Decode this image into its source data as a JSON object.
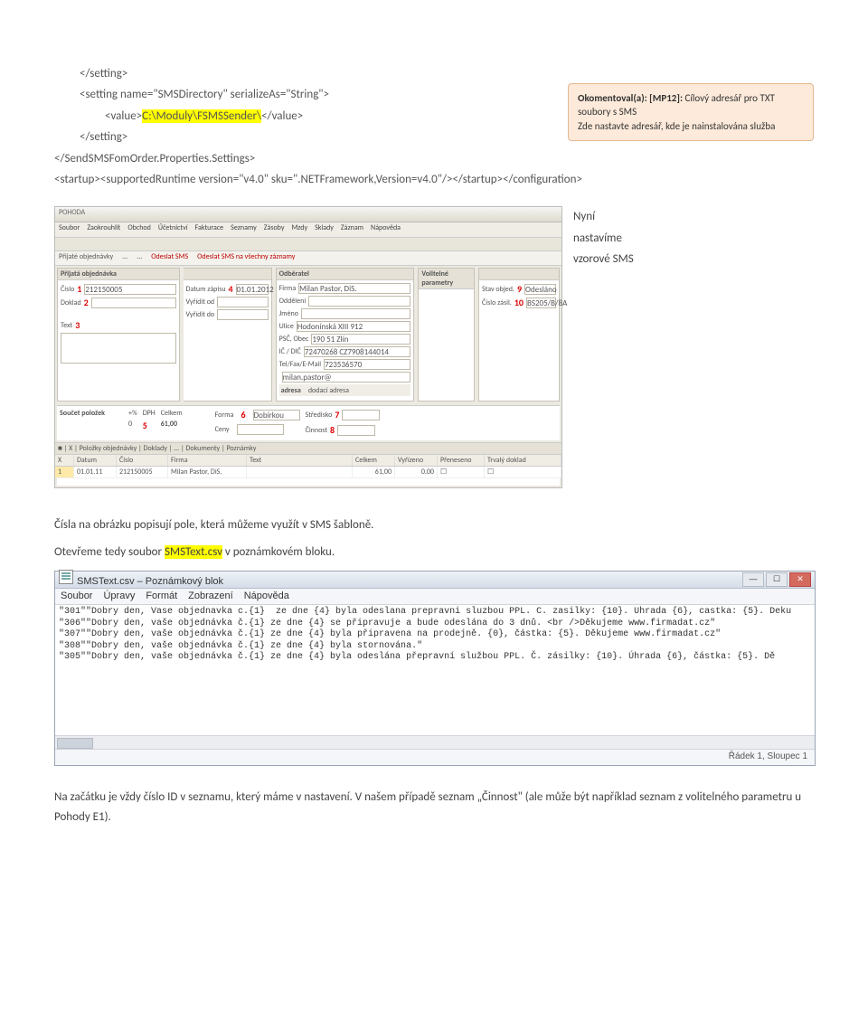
{
  "code": {
    "l1": "</setting>",
    "l2_a": "<setting name=\"SMSDirectory\" serializeAs=\"String\">",
    "l3_a": "<value>",
    "l3_hl": "C:\\Moduly\\FSMSSender\\",
    "l3_b": "</value>",
    "l4": "</setting>",
    "l5": "</SendSMSFomOrder.Properties.Settings>",
    "l6": "<startup><supportedRuntime version=\"v4.0\" sku=\".NETFramework,Version=v4.0\"/></startup></configuration>"
  },
  "comment": {
    "head": "Okomentoval(a): [MP12]: ",
    "body1": "Cílový adresář pro TXT soubory s SMS",
    "body2": "Zde nastavte adresář, kde je nainstalována služba"
  },
  "side_note": {
    "l1": "Nyní",
    "l2": "nastavíme",
    "l3": "vzorové SMS"
  },
  "app": {
    "title": "POHODA",
    "menu": [
      "Soubor",
      "Zaokrouhlit",
      "Obchod",
      "Účetnictví",
      "Fakturace",
      "Seznamy",
      "Zásoby",
      "Mzdy",
      "Sklady",
      "Záznam",
      "Nápověda"
    ],
    "subbar": [
      "Přijaté objednávky",
      "...",
      "...",
      "Odeslat SMS",
      "Odeslat SMS na všechny záznamy"
    ],
    "panel1": {
      "head": "Přijatá objednávka",
      "rows": [
        {
          "lbl": "Číslo",
          "num": "1",
          "val": "212150005"
        },
        {
          "lbl": "Doklad",
          "num": "2",
          "val": ""
        },
        {
          "lbl": "",
          "num": "",
          "val": ""
        },
        {
          "lbl": "Text",
          "num": "3",
          "val": ""
        }
      ],
      "rows2": [
        {
          "lbl": "Datum zápisu",
          "num": "4",
          "val": "01.01.2012"
        },
        {
          "lbl": "Vyřídit od",
          "val": ""
        },
        {
          "lbl": "Vyřídit do",
          "val": ""
        }
      ]
    },
    "panel2": {
      "head": "Odběratel",
      "rows": [
        {
          "lbl": "Firma",
          "val": "Milan Pastor, DiS."
        },
        {
          "lbl": "Oddělení",
          "val": ""
        },
        {
          "lbl": "Jméno",
          "val": ""
        },
        {
          "lbl": "Ulice",
          "val": "Hodonínská XIII 912"
        },
        {
          "lbl": "PSČ, Obec",
          "val": "190 51 Zlín"
        },
        {
          "lbl": "IČ / DIČ",
          "val": "72470268   CZ7908144014"
        },
        {
          "lbl": "Tel/Fax/E-Mail",
          "val": "723536570"
        },
        {
          "lbl": "",
          "val": "milan.pastor@"
        },
        {
          "lbl": "adresa",
          "val": "dodací adresa"
        }
      ]
    },
    "panel3": {
      "head": "Volitelné parametry"
    },
    "panel4": {
      "rows": [
        {
          "lbl": "Stav objed.",
          "num": "9",
          "val": "Odesláno"
        },
        {
          "lbl": "Číslo zásil.",
          "num": "10",
          "val": "BS205/B/8A"
        }
      ]
    },
    "sum": {
      "head": "Součet položek",
      "cols": [
        "+%",
        "DPH",
        "Celkem"
      ],
      "vals": [
        "0",
        "5",
        "61,00"
      ],
      "forma_lbl": "Forma",
      "forma_num": "6",
      "forma_val": "Dobírkou",
      "stredisko_lbl": "Středisko",
      "stredisko_num": "7",
      "cinnost_lbl": "Činnost",
      "cinnost_num": "8",
      "cena_lbl": "Ceny"
    },
    "grid": {
      "tabs": "■ | X | Položky objednávky | Doklady | ... | Dokumenty | Poznámky",
      "head": [
        "X",
        "Datum",
        "Číslo",
        "Firma",
        "Text",
        "Celkem",
        "Vyřízeno",
        "Přeneseno",
        "Trvalý doklad"
      ],
      "row": [
        "",
        "01.01.11",
        "212150005",
        "Milan Pastor, DiS.",
        "",
        "61,00",
        "",
        "",
        ""
      ]
    }
  },
  "para1": "Čísla na obrázku popisují pole, která můžeme využít v SMS šabloně.",
  "para2_a": "Otevřeme tedy soubor ",
  "para2_hl": "SMSText.csv",
  "para2_b": " v poznámkovém bloku.",
  "notepad": {
    "title": "SMSText.csv – Poznámkový blok",
    "menu": [
      "Soubor",
      "Úpravy",
      "Formát",
      "Zobrazení",
      "Nápověda"
    ],
    "lines": [
      "\"301\"\"Dobry den, Vase objednavka c.{1}  ze dne {4} byla odeslana prepravni sluzbou PPL. C. zasilky: {10}. Uhrada {6}, castka: {5}. Deku",
      "\"306\"\"Dobry den, vaše objednávka č.{1} ze dne {4} se připravuje a bude odeslána do 3 dnů. <br />Děkujeme www.firmadat.cz\"",
      "\"307\"\"Dobry den, vaše objednávka č.{1} ze dne {4} byla připravena na prodejně. {0}, částka: {5}. Děkujeme www.firmadat.cz\"",
      "\"308\"\"Dobry den, vaše objednávka č.{1} ze dne {4} byla stornována.\"",
      "\"305\"\"Dobry den, vaše objednávka č.{1} ze dne {4} byla odeslána přepravní službou PPL. Č. zásilky: {10}. Úhrada {6}, částka: {5}. Dě"
    ],
    "status": "Řádek 1, Sloupec 1"
  },
  "para3": "Na začátku je vždy číslo ID v seznamu, který máme v nastavení. V našem případě seznam „Činnost\" (ale může být například seznam z volitelného parametru u Pohody E1)."
}
